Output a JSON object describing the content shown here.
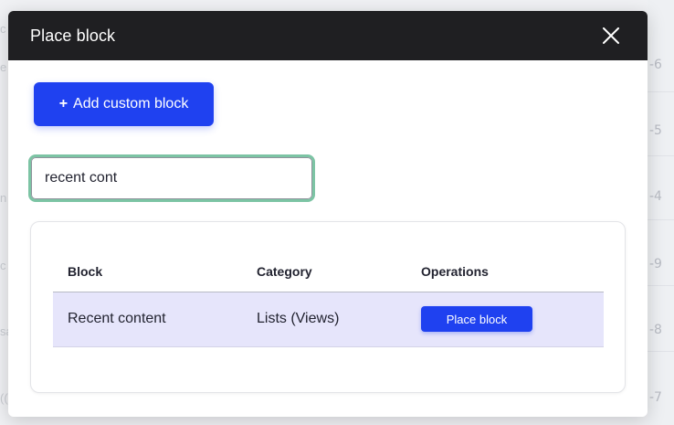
{
  "background": {
    "row_numbers": [
      "-6",
      "-5",
      "-4",
      "-9",
      "-8",
      "-7"
    ],
    "left_fragments": [
      "c",
      "e",
      "n",
      "c",
      "sa",
      "(("
    ]
  },
  "dialog": {
    "title": "Place block",
    "close_icon": "close-icon",
    "add_custom_block": {
      "icon": "+",
      "label": "Add custom block"
    },
    "search": {
      "value": "recent cont",
      "placeholder": ""
    },
    "table": {
      "columns": [
        "Block",
        "Category",
        "Operations"
      ],
      "rows": [
        {
          "block": "Recent content",
          "category": "Lists (Views)",
          "operation_label": "Place block"
        }
      ]
    }
  },
  "colors": {
    "header_bg": "#1f1f22",
    "accent": "#1f41f0",
    "focus_ring": "#7cc4a4",
    "row_highlight": "#e6e5fb"
  }
}
